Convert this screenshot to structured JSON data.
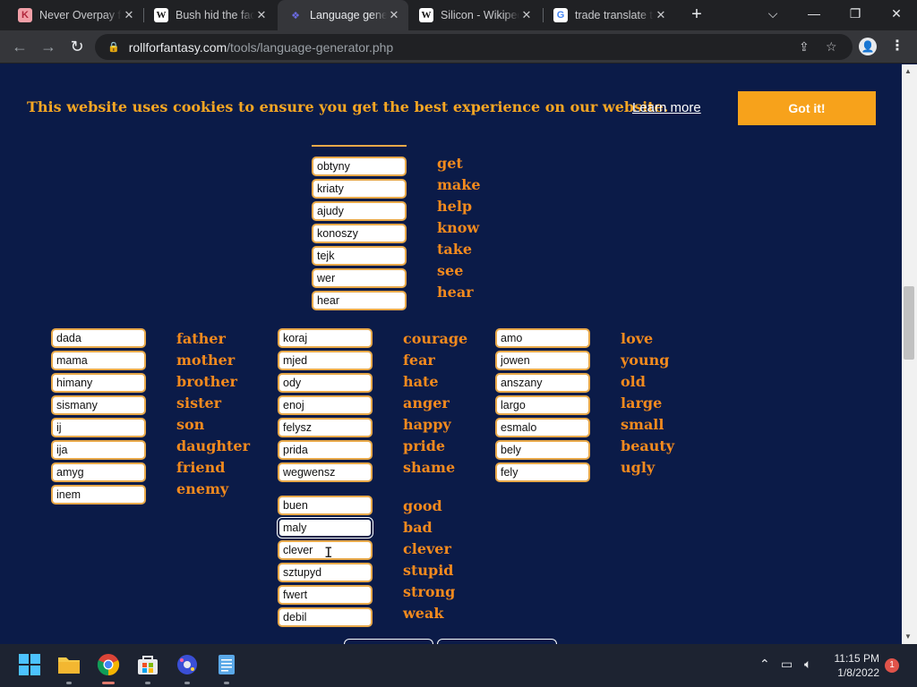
{
  "browser": {
    "tabs": [
      {
        "title": "Never Overpay for",
        "favicon": "K",
        "favicon_style": "fav-k"
      },
      {
        "title": "Bush hid the facts",
        "favicon": "W",
        "favicon_style": "fav-w"
      },
      {
        "title": "Language generator",
        "favicon": "❖",
        "favicon_style": "fav-r",
        "active": true
      },
      {
        "title": "Silicon - Wikipedia",
        "favicon": "W",
        "favicon_style": "fav-w"
      },
      {
        "title": "trade translate to",
        "favicon": "G",
        "favicon_style": "fav-g"
      }
    ],
    "url_host": "rollforfantasy.com",
    "url_path": "/tools/language-generator.php"
  },
  "cookie_banner": {
    "message": "This website uses cookies to ensure you get the best experience on our website.",
    "link": "Learn more",
    "button": "Got it!"
  },
  "groups": {
    "verbs": {
      "fields": [
        "obtyny",
        "kriaty",
        "ajudy",
        "konoszy",
        "tejk",
        "wer",
        "hear"
      ],
      "words": [
        "get",
        "make",
        "help",
        "know",
        "take",
        "see",
        "hear"
      ]
    },
    "family": {
      "fields": [
        "dada",
        "mama",
        "himany",
        "sismany",
        "ij",
        "ija",
        "amyg",
        "inem"
      ],
      "words": [
        "father",
        "mother",
        "brother",
        "sister",
        "son",
        "daughter",
        "friend",
        "enemy"
      ]
    },
    "emotions": {
      "fields": [
        "koraj",
        "mjed",
        "ody",
        "enoj",
        "felysz",
        "prida",
        "wegwensz"
      ],
      "words": [
        "courage",
        "fear",
        "hate",
        "anger",
        "happy",
        "pride",
        "shame"
      ]
    },
    "traits": {
      "fields": [
        "buen",
        "maly",
        "clever",
        "sztupyd",
        "fwert",
        "debil"
      ],
      "words": [
        "good",
        "bad",
        "clever",
        "stupid",
        "strong",
        "weak"
      ]
    },
    "descriptors": {
      "fields": [
        "amo",
        "jowen",
        "anszany",
        "largo",
        "esmalo",
        "bely",
        "fely"
      ],
      "words": [
        "love",
        "young",
        "old",
        "large",
        "small",
        "beauty",
        "ugly"
      ]
    }
  },
  "taskbar": {
    "time": "11:15 PM",
    "date": "1/8/2022",
    "notifications": "1"
  },
  "colors": {
    "page_bg": "#0b1b48",
    "accent_orange": "#f28a1e",
    "button_orange": "#f7a21b",
    "field_border": "#e8a94a"
  }
}
